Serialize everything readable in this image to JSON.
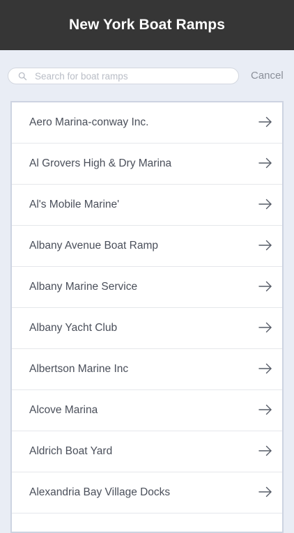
{
  "header": {
    "title": "New York Boat Ramps"
  },
  "search": {
    "placeholder": "Search for boat ramps",
    "value": "",
    "cancel_label": "Cancel",
    "icon": "search-icon"
  },
  "list": {
    "item_icon": "arrow-right-icon",
    "items": [
      {
        "label": "Aero Marina-conway Inc."
      },
      {
        "label": "Al Grovers High & Dry Marina"
      },
      {
        "label": "Al's Mobile Marine'"
      },
      {
        "label": "Albany Avenue Boat Ramp"
      },
      {
        "label": "Albany Marine Service"
      },
      {
        "label": "Albany Yacht Club"
      },
      {
        "label": "Albertson Marine Inc"
      },
      {
        "label": "Alcove Marina"
      },
      {
        "label": "Aldrich Boat Yard"
      },
      {
        "label": "Alexandria Bay Village Docks"
      },
      {
        "label": ""
      }
    ]
  },
  "colors": {
    "header_bg": "#363636",
    "page_bg": "#e9edf5",
    "text": "#4a4f5a"
  }
}
